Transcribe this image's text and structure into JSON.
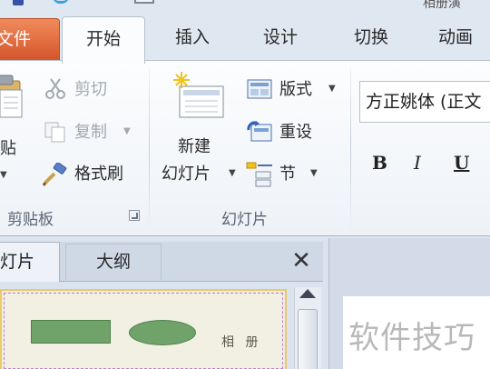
{
  "title_bar": {
    "title_fragment": "相册演"
  },
  "tabs": {
    "file": "文件",
    "home": "开始",
    "insert": "插入",
    "design": "设计",
    "transition": "切换",
    "animation": "动画"
  },
  "clipboard": {
    "paste": "贴",
    "cut": "剪切",
    "copy": "复制",
    "format_painter": "格式刷",
    "group_label": "剪贴板"
  },
  "slides": {
    "new_slide_line1": "新建",
    "new_slide_line2": "幻灯片",
    "layout": "版式",
    "reset": "重设",
    "section": "节",
    "group_label": "幻灯片"
  },
  "font": {
    "font_name": "方正姚体 (正文",
    "bold": "B",
    "italic": "I",
    "underline": "U"
  },
  "pane": {
    "tab_slides": "灯片",
    "tab_outline": "大纲",
    "close": "✕",
    "thumbnail_text": "相 册"
  },
  "watermark": "软件技巧",
  "colors": {
    "file_tab": "#d4552a",
    "thumb_shape": "#6fa36a",
    "thumb_border": "#e9c96a"
  }
}
